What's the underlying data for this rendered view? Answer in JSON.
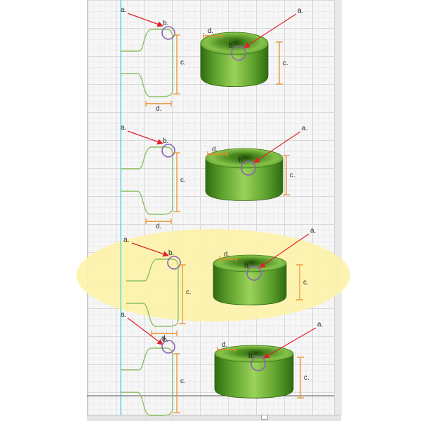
{
  "labels": {
    "a": "a.",
    "b": "b.",
    "c": "c.",
    "d": "d."
  },
  "colors": {
    "profile": "#8cc063",
    "arrow": "#e0202a",
    "circle": "#8a64b4",
    "dimension": "#e88a2a",
    "guide": "#58d6e6",
    "highlight": "#fdf3a8",
    "body_dark": "#2f6b10",
    "body_mid": "#5a9e2a",
    "body_light": "#9bd35a"
  },
  "panels": [
    {
      "id": "1",
      "highlighted": false
    },
    {
      "id": "2",
      "highlighted": false
    },
    {
      "id": "3",
      "highlighted": true
    },
    {
      "id": "4",
      "highlighted": false
    }
  ]
}
